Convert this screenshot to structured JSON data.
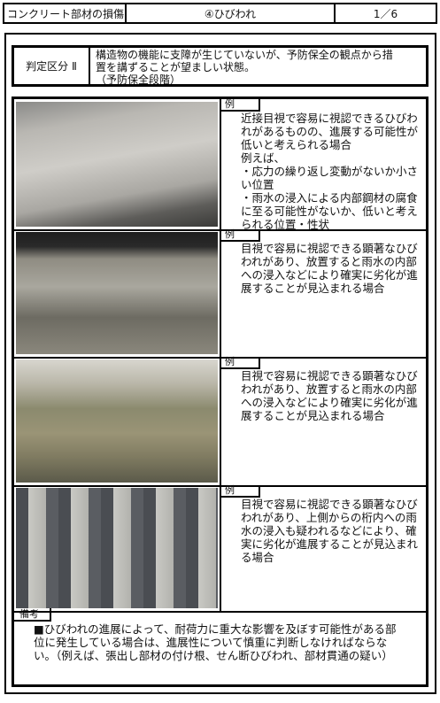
{
  "header": {
    "category": "コンクリート部材の損傷",
    "damage_type": "④ひびわれ",
    "page": "1／6"
  },
  "judgment": {
    "label": "判定区分 Ⅱ",
    "description": "構造物の機能に支障が生じていないが、予防保全の観点から措\n置を講ずることが望ましい状態。\n（予防保全段階）"
  },
  "examples": [
    {
      "label": "例",
      "text": "近接目視で容易に視認できるひびわ\nれがあるものの、進展する可能性が\n低いと考えられる場合\n例えば、\n・応力の繰り返し変動がないか小さ\nい位置\n・雨水の浸入による内部鋼材の腐食\nに至る可能性がないか、低いと考え\nられる位置・性状"
    },
    {
      "label": "例",
      "text": "目視で容易に視認できる顕著なひび\nわれがあり、放置すると雨水の内部\nへの浸入などにより確実に劣化が進\n展することが見込まれる場合"
    },
    {
      "label": "例",
      "text": "目視で容易に視認できる顕著なひび\nわれがあり、放置すると雨水の内部\nへの浸入などにより確実に劣化が進\n展することが見込まれる場合"
    },
    {
      "label": "例",
      "text": "目視で容易に視認できる顕著なひび\nわれがあり、上側からの桁内への雨\n水の浸入も疑われるなどにより、確\n実に劣化が進展することが見込まれ\nる場合"
    }
  ],
  "remarks": {
    "label": "備考",
    "text": "■ひびわれの進展によって、耐荷力に重大な影響を及ぼす可能性がある部\n位に発生している場合は、進展性について慎重に判断しなければならな\nい。（例えば、張出し部材の付け根、せん断ひびわれ、部材貫通の疑い）"
  }
}
